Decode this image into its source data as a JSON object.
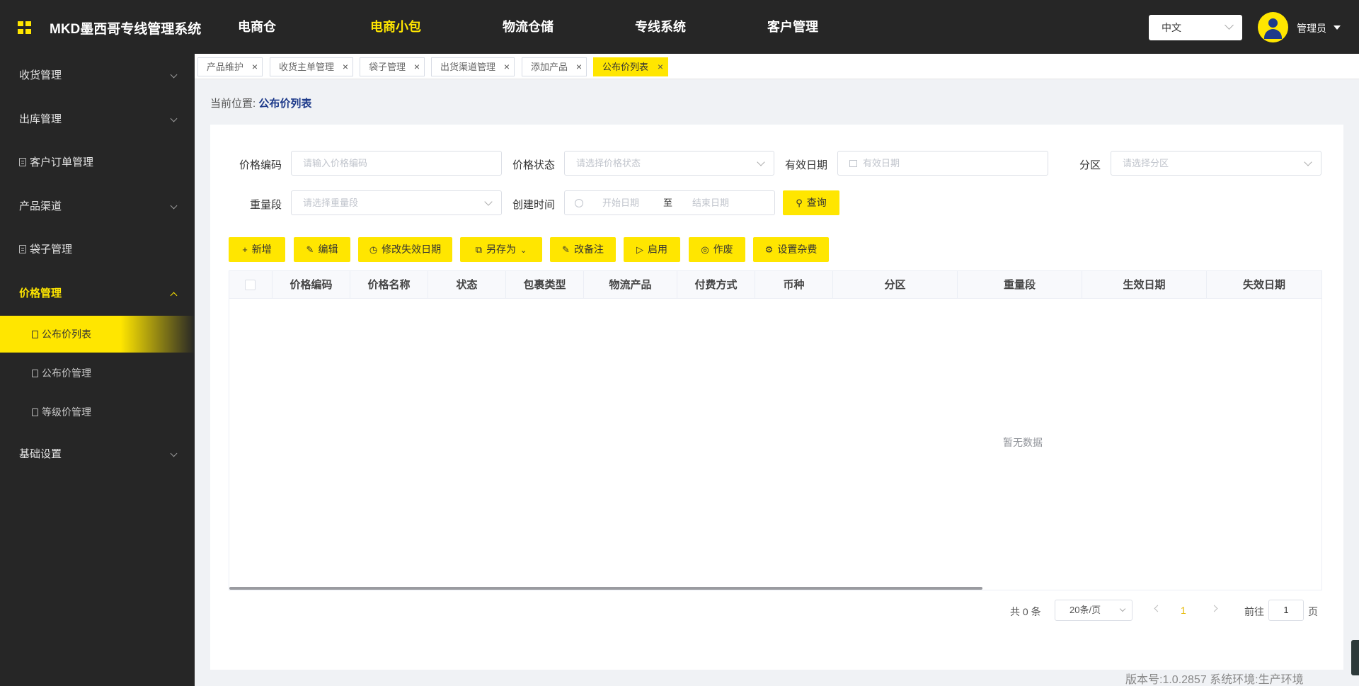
{
  "app": {
    "title": "MKD墨西哥专线管理系统"
  },
  "nav": [
    {
      "label": "电商仓",
      "active": false
    },
    {
      "label": "电商小包",
      "active": true
    },
    {
      "label": "物流仓储",
      "active": false
    },
    {
      "label": "专线系统",
      "active": false
    },
    {
      "label": "客户管理",
      "active": false
    }
  ],
  "language": {
    "value": "中文"
  },
  "user": {
    "name": "管理员"
  },
  "sidebar": {
    "items": [
      {
        "label": "收货管理"
      },
      {
        "label": "出库管理"
      },
      {
        "label": "客户订单管理"
      },
      {
        "label": "产品渠道"
      },
      {
        "label": "袋子管理"
      },
      {
        "label": "价格管理"
      },
      {
        "label": "基础设置"
      }
    ],
    "subitems": [
      {
        "label": "公布价列表"
      },
      {
        "label": "公布价管理"
      },
      {
        "label": "等级价管理"
      }
    ]
  },
  "tabs": [
    {
      "label": "产品维护"
    },
    {
      "label": "收货主单管理"
    },
    {
      "label": "袋子管理"
    },
    {
      "label": "出货渠道管理"
    },
    {
      "label": "添加产品"
    },
    {
      "label": "公布价列表"
    }
  ],
  "breadcrumb": {
    "prefix": "当前位置:",
    "current": "公布价列表"
  },
  "filters": {
    "price_code": {
      "label": "价格编码",
      "placeholder": "请输入价格编码"
    },
    "price_status": {
      "label": "价格状态",
      "placeholder": "请选择价格状态"
    },
    "effective_date": {
      "label": "有效日期",
      "placeholder": "有效日期"
    },
    "zone": {
      "label": "分区",
      "placeholder": "请选择分区"
    },
    "weight_range": {
      "label": "重量段",
      "placeholder": "请选择重量段"
    },
    "created_time": {
      "label": "创建时间",
      "start_placeholder": "开始日期",
      "separator": "至",
      "end_placeholder": "结束日期"
    },
    "query_button": "查询"
  },
  "toolbar": {
    "add": "新增",
    "edit": "编辑",
    "modify_expiry": "修改失效日期",
    "save_as": "另存为",
    "change_remark": "改备注",
    "enable": "启用",
    "void": "作废",
    "set_surcharge": "设置杂费"
  },
  "table": {
    "columns": [
      "价格编码",
      "价格名称",
      "状态",
      "包裹类型",
      "物流产品",
      "付费方式",
      "币种",
      "分区",
      "重量段",
      "生效日期",
      "失效日期"
    ],
    "rows": [],
    "empty_text": "暂无数据"
  },
  "pagination": {
    "total": "共 0 条",
    "page_size": "20条/页",
    "current_page": "1",
    "goto_prefix": "前往",
    "goto_value": "1",
    "goto_suffix": "页"
  },
  "footer": {
    "version": "版本号:1.0.2857 系统环境:生产环境"
  },
  "colors": {
    "accent": "#ffe600",
    "dark": "#262626",
    "link": "#1d3a8a"
  }
}
